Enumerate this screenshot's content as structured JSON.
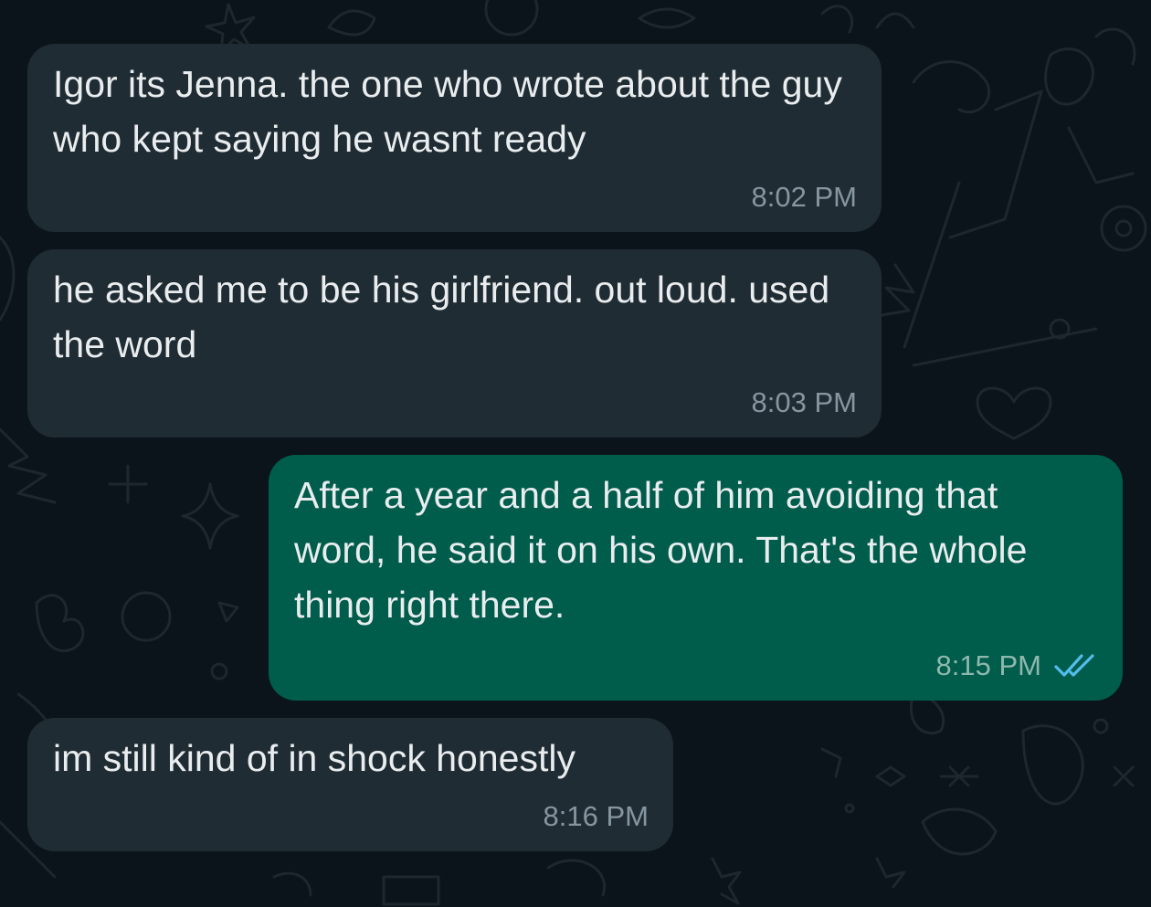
{
  "conversation": {
    "messages": [
      {
        "direction": "incoming",
        "text": "Igor its Jenna. the one who wrote about the guy who kept saying he wasnt ready",
        "time": "8:02 PM"
      },
      {
        "direction": "incoming",
        "text": "he asked me to be his girlfriend. out loud. used the word",
        "time": "8:03 PM"
      },
      {
        "direction": "outgoing",
        "text": "After a year and a half of him avoiding that word, he said it on his own. That's the whole thing right there.",
        "time": "8:15 PM",
        "status_icon": "double-check-icon",
        "status_color": "#53bdeb"
      },
      {
        "direction": "incoming",
        "text": "im still kind of in shock honestly",
        "time": "8:16 PM"
      }
    ]
  },
  "theme": {
    "background": "#0b141a",
    "incoming_bubble": "#202c33",
    "outgoing_bubble": "#005c4b",
    "text_color": "#e9edef",
    "time_color": "#8696a0"
  }
}
